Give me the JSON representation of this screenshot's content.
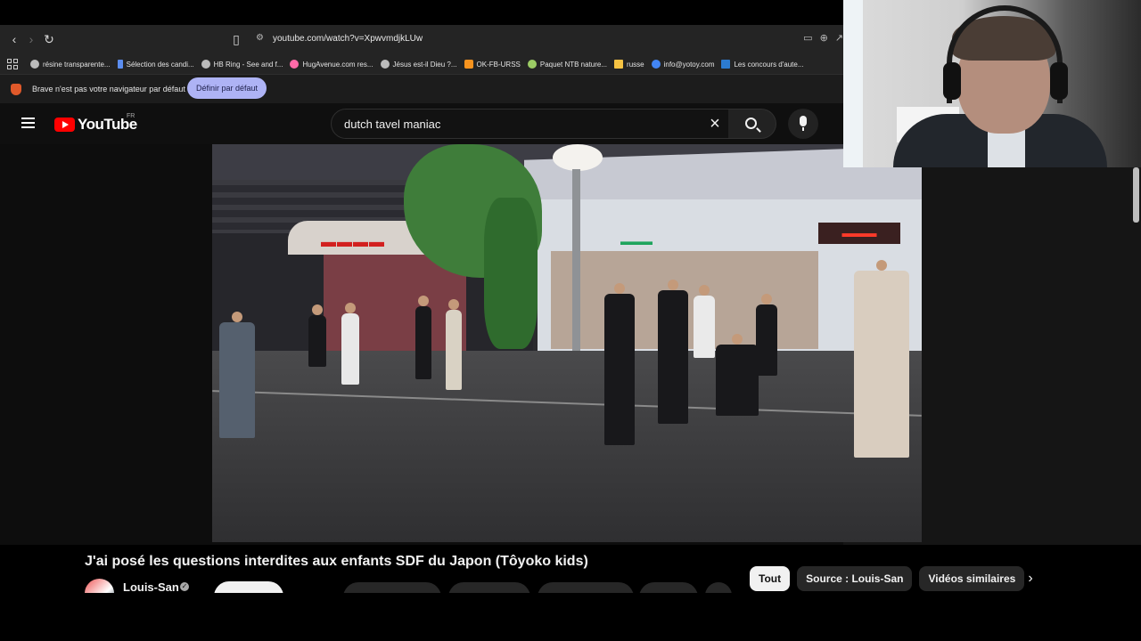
{
  "browser": {
    "url": "youtube.com/watch?v=XpwvmdjkLUw",
    "bookmarks": [
      {
        "label": "résine transparente...",
        "icon": "globe-icon",
        "color": "#bbbbbb"
      },
      {
        "label": "Sélection des candi...",
        "icon": "doc-icon",
        "color": "#5b8def"
      },
      {
        "label": "HB Ring - See and f...",
        "icon": "globe-icon",
        "color": "#bbbbbb"
      },
      {
        "label": "HugAvenue.com res...",
        "icon": "heart-icon",
        "color": "#ff6aa8"
      },
      {
        "label": "Jésus est-il Dieu ?...",
        "icon": "globe-icon",
        "color": "#bbbbbb"
      },
      {
        "label": "OK-FB-URSS",
        "icon": "ok-icon",
        "color": "#f7931e"
      },
      {
        "label": "Paquet NTB nature...",
        "icon": "leaf-icon",
        "color": "#9ccc65"
      },
      {
        "label": "russe",
        "icon": "folder-icon",
        "color": "#f6c343"
      },
      {
        "label": "info@yotoy.com",
        "icon": "google-icon",
        "color": "#4285f4"
      },
      {
        "label": "Les concours d'aute...",
        "icon": "image-icon",
        "color": "#2c7bd0"
      }
    ],
    "infobar": {
      "message": "Brave n'est pas votre navigateur par défaut",
      "button": "Définir par défaut"
    }
  },
  "youtube": {
    "logo_text": "YouTube",
    "country": "FR",
    "search_value": "dutch tavel maniac",
    "accent": "#ff0000"
  },
  "video": {
    "title": "J'ai posé les questions interdites aux enfants SDF du Japon (Tôyoko kids)",
    "channel": "Louis-San"
  },
  "chips": [
    {
      "label": "Tout",
      "active": true
    },
    {
      "label": "Source : Louis-San",
      "active": false
    },
    {
      "label": "Vidéos similaires",
      "active": false
    }
  ]
}
